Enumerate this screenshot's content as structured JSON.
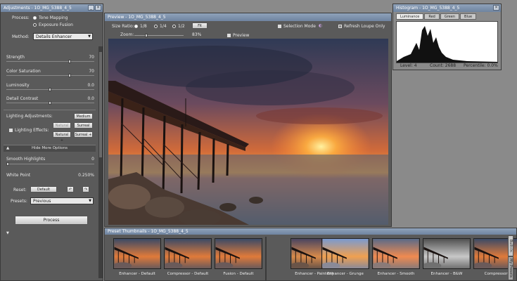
{
  "adjustments": {
    "title": "Adjustments - 1O_MG_5388_4_5",
    "process_label": "Process:",
    "process_options": [
      "Tone Mapping",
      "Exposure Fusion"
    ],
    "method_label": "Method:",
    "method_value": "Details Enhancer",
    "sliders": [
      {
        "label": "Strength",
        "value": "70",
        "pos": 0.7
      },
      {
        "label": "Color Saturation",
        "value": "70",
        "pos": 0.7
      },
      {
        "label": "Luminosity",
        "value": "0.0",
        "pos": 0.48
      },
      {
        "label": "Detail Contrast",
        "value": "0.0",
        "pos": 0.48
      }
    ],
    "lighting_label": "Lighting Adjustments:",
    "medium_btn": "Medium",
    "lighting_effects_label": "Lighting Effects:",
    "natural_btn": "Natural",
    "surreal_btn": "Surreal",
    "natural_plus_btn": "Natural +",
    "surreal_plus_btn": "Surreal +",
    "hide_more_options": "Hide More Options",
    "smooth_highlights_label": "Smooth Highlights",
    "smooth_highlights_value": "0",
    "white_point_label": "White Point",
    "white_point_value": "0.250%",
    "reset_label": "Reset:",
    "default_btn": "Default",
    "presets_label": "Presets:",
    "presets_value": "Previous",
    "process_btn": "Process"
  },
  "preview": {
    "title": "Preview - 1O_MG_5388_4_5",
    "size_ratio_label": "Size Ratio:",
    "ratio_options": [
      "1/8",
      "1/4",
      "1/2"
    ],
    "fit_btn": "Fit",
    "selection_mode": "Selection Mode",
    "refresh_loupe": "Refresh Loupe Only",
    "zoom_label": "Zoom:",
    "zoom_value": "83%",
    "preview_check": "Preview"
  },
  "histogram": {
    "title": "Histogram - 1O_MG_5388_4_5",
    "tabs": [
      "Luminance",
      "Red",
      "Green",
      "Blue"
    ],
    "level": "Level: 4",
    "count": "Count: 2688",
    "percentile": "Percentile: 0.0%"
  },
  "thumbnails": {
    "title": "Preset Thumbnails - 1O_MG_5388_4_5",
    "items": [
      {
        "label": "Enhancer - Default",
        "style": "default"
      },
      {
        "label": "Compressor - Default",
        "style": "default"
      },
      {
        "label": "Fusion - Default",
        "style": "default"
      },
      {
        "label": "Enhancer - Painterly",
        "style": "painterly"
      },
      {
        "label": "Enhancer - Grunge",
        "style": "grunge"
      },
      {
        "label": "Enhancer - Smooth",
        "style": "smooth"
      },
      {
        "label": "Enhancer - B&W",
        "style": "bw"
      },
      {
        "label": "Compressor -",
        "style": "default"
      }
    ],
    "side_tabs": [
      "Built-In",
      "My Presets"
    ]
  },
  "colors": {
    "title_bar": "#7f93ae",
    "panel_bg": "#5a5a5a",
    "desktop_bg": "#8a8a8a"
  }
}
